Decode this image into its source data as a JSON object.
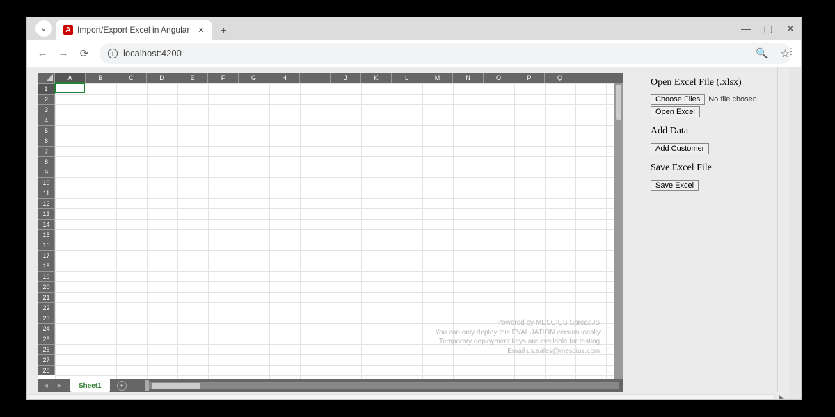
{
  "browser": {
    "tab_title": "Import/Export Excel in Angular",
    "favicon_letter": "A",
    "url": "localhost:4200"
  },
  "spreadsheet": {
    "columns": [
      "A",
      "B",
      "C",
      "D",
      "E",
      "F",
      "G",
      "H",
      "I",
      "J",
      "K",
      "L",
      "M",
      "N",
      "O",
      "P",
      "Q"
    ],
    "row_count": 28,
    "active_cell": {
      "row": 1,
      "col": "A"
    },
    "sheet_tab": "Sheet1",
    "watermark": [
      "Powered by MESCIUS SpreadJS.",
      "You can only deploy this EVALUATION version locally.",
      "Temporary deployment keys are available for testing.",
      "Email us.sales@mescius.com."
    ]
  },
  "side": {
    "open_title": "Open Excel File (.xlsx)",
    "choose_files_label": "Choose Files",
    "no_file_text": "No file chosen",
    "open_button": "Open Excel",
    "add_title": "Add Data",
    "add_button": "Add Customer",
    "save_title": "Save Excel File",
    "save_button": "Save Excel"
  }
}
